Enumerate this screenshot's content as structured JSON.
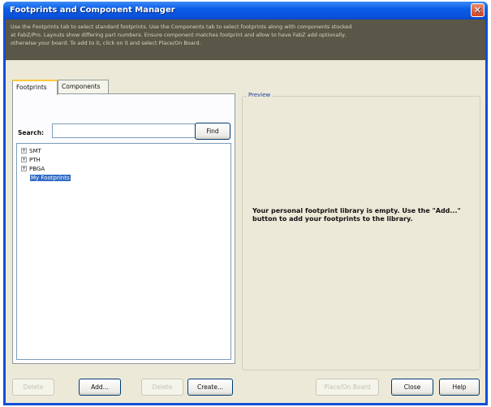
{
  "window": {
    "title": "Footprints and Component Manager",
    "close_glyph": "✕",
    "banner_lines": [
      "Use the Footprints tab to select standard footprints. Use the Components tab to select footprints along with components stocked",
      "at FabZ/Pro. Layouts show differing part numbers. Ensure component matches footprint and allow to have FabZ add optionally,",
      "otherwise your board. To add to it, click on it and select Place/On Board."
    ]
  },
  "tabs": [
    {
      "label": "Footprints",
      "active": true
    },
    {
      "label": "Components",
      "active": false
    }
  ],
  "search": {
    "label": "Search:",
    "value": "",
    "placeholder": "",
    "find_label": "Find"
  },
  "tree": [
    {
      "label": "SMT",
      "expander": "+",
      "selected": false
    },
    {
      "label": "PTH",
      "expander": "+",
      "selected": false
    },
    {
      "label": "PBGA",
      "expander": "+",
      "selected": false
    },
    {
      "label": "My Footprints",
      "expander": "",
      "selected": true
    }
  ],
  "preview": {
    "label": "Preview",
    "message": "Your personal footprint library is empty. Use the \"Add...\" button to add your footprints to the library."
  },
  "buttons": {
    "left_1": "Delete",
    "add": "Add...",
    "left_3": "Delete",
    "create": "Create...",
    "place": "Place/On Board",
    "close": "Close",
    "help": "Help"
  }
}
